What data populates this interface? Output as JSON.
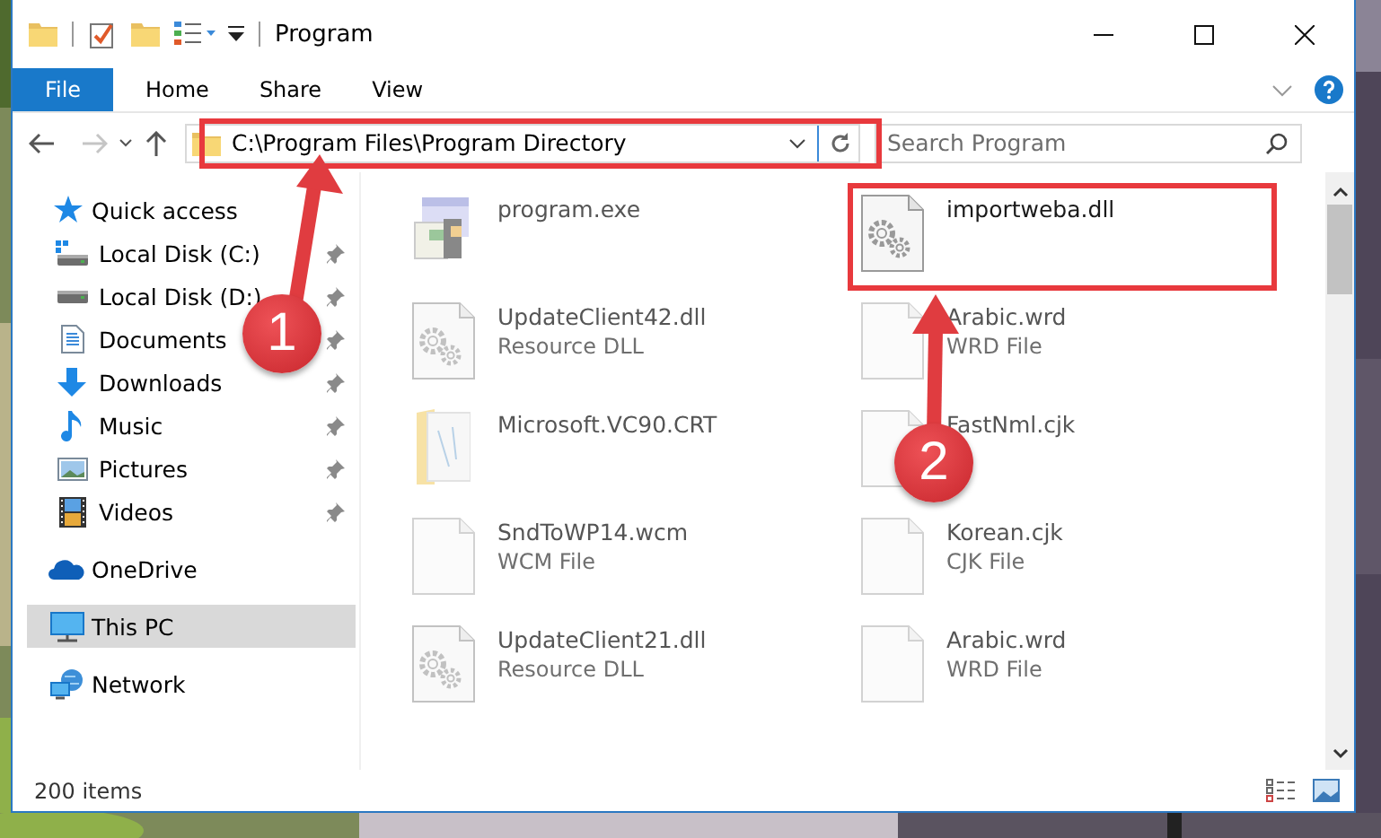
{
  "window": {
    "title": "Program"
  },
  "ribbon": {
    "tabs": [
      {
        "label": "File",
        "kind": "file"
      },
      {
        "label": "Home",
        "kind": "tab"
      },
      {
        "label": "Share",
        "kind": "tab"
      },
      {
        "label": "View",
        "kind": "tab"
      }
    ]
  },
  "address": {
    "path": "C:\\Program Files\\Program Directory"
  },
  "search": {
    "placeholder": "Search Program"
  },
  "nav": {
    "groups": [
      {
        "label": "Quick access",
        "kind": "star",
        "selected": false,
        "children": [
          {
            "label": "Local Disk (C:)",
            "kind": "system-drive",
            "pinned": true,
            "selected": false
          },
          {
            "label": "Local Disk (D:)",
            "kind": "drive",
            "pinned": true,
            "selected": false
          },
          {
            "label": "Documents",
            "kind": "documents",
            "pinned": true,
            "selected": false
          },
          {
            "label": "Downloads",
            "kind": "downloads",
            "pinned": true,
            "selected": false
          },
          {
            "label": "Music",
            "kind": "music",
            "pinned": true,
            "selected": false
          },
          {
            "label": "Pictures",
            "kind": "pictures",
            "pinned": true,
            "selected": false
          },
          {
            "label": "Videos",
            "kind": "videos",
            "pinned": true,
            "selected": false
          }
        ]
      },
      {
        "label": "OneDrive",
        "kind": "cloud",
        "selected": false
      },
      {
        "label": "This PC",
        "kind": "computer",
        "selected": true
      },
      {
        "label": "Network",
        "kind": "network",
        "selected": false
      }
    ]
  },
  "files": [
    {
      "name": "program.exe",
      "kind": "exe",
      "blurred": true
    },
    {
      "name": "UpdateClient42.dll",
      "type": "Resource DLL",
      "kind": "dll",
      "blurred": true
    },
    {
      "name": "Microsoft.VC90.CRT",
      "kind": "folder",
      "blurred": true
    },
    {
      "name": "SndToWP14.wcm",
      "type": "WCM File",
      "kind": "file",
      "blurred": true
    },
    {
      "name": "UpdateClient21.dll",
      "type": "Resource DLL",
      "kind": "dll",
      "blurred": true
    },
    {
      "name": "importweba.dll",
      "kind": "dll",
      "blurred": false
    },
    {
      "name": "Arabic.wrd",
      "type": "WRD File",
      "kind": "file",
      "blurred": true
    },
    {
      "name": "FastNml.cjk",
      "kind": "file",
      "blurred": true
    },
    {
      "name": "Korean.cjk",
      "type": "CJK File",
      "kind": "file",
      "blurred": true
    },
    {
      "name": "Arabic.wrd",
      "type": "WRD File",
      "kind": "file",
      "blurred": true
    }
  ],
  "status_bar": {
    "count": "200 items"
  },
  "annotations": {
    "markers": [
      {
        "label": "1"
      },
      {
        "label": "2"
      }
    ]
  }
}
